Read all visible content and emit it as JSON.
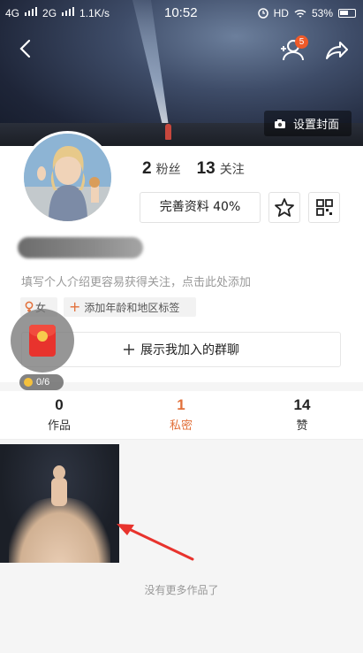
{
  "status_bar": {
    "network1": "4G",
    "network2": "2G",
    "speed": "1.1K/s",
    "time": "10:52",
    "hd": "HD",
    "battery": "53%"
  },
  "header": {
    "follow_badge": "5",
    "set_cover_label": "设置封面"
  },
  "profile": {
    "fans_count": "2",
    "fans_label": "粉丝",
    "follow_count": "13",
    "follow_label": "关注",
    "complete_label": "完善资料 40%",
    "intro_placeholder": "填写个人介绍更容易获得关注，点击此处添加",
    "gender_tag": "女",
    "add_tag_label": "添加年龄和地区标签",
    "groups_label": "展示我加入的群聊",
    "coin_count": "0/6"
  },
  "tabs": [
    {
      "num": "0",
      "label": "作品"
    },
    {
      "num": "1",
      "label": "私密"
    },
    {
      "num": "14",
      "label": "赞"
    }
  ],
  "footer": {
    "no_more": "没有更多作品了"
  },
  "colors": {
    "accent": "#e2703a",
    "badge": "#ef5a29",
    "arrow": "#e8332d"
  }
}
